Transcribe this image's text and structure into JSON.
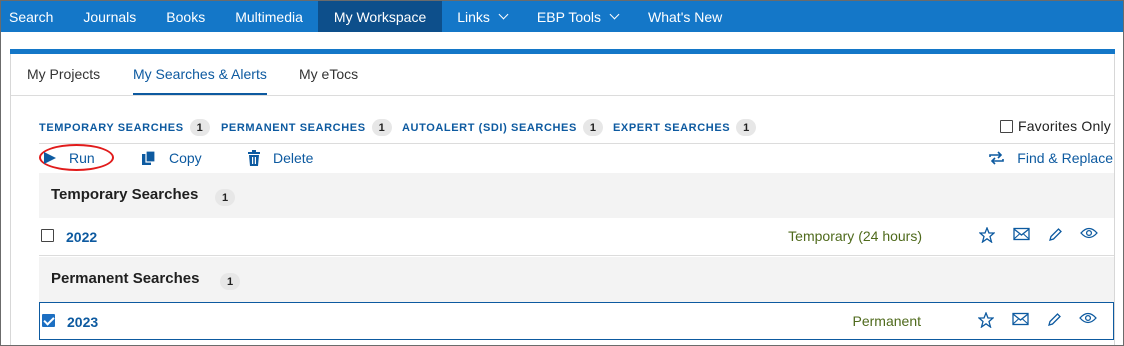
{
  "nav": {
    "items": [
      {
        "label": "Search"
      },
      {
        "label": "Journals"
      },
      {
        "label": "Books"
      },
      {
        "label": "Multimedia"
      },
      {
        "label": "My Workspace",
        "active": true
      },
      {
        "label": "Links",
        "dropdown": true
      },
      {
        "label": "EBP Tools",
        "dropdown": true
      },
      {
        "label": "What's New"
      }
    ]
  },
  "subtabs": [
    "My Projects",
    "My Searches & Alerts",
    "My eTocs"
  ],
  "filters": [
    {
      "label": "TEMPORARY SEARCHES",
      "count": "1"
    },
    {
      "label": "PERMANENT SEARCHES",
      "count": "1"
    },
    {
      "label": "AUTOALERT (SDI) SEARCHES",
      "count": "1"
    },
    {
      "label": "EXPERT SEARCHES",
      "count": "1"
    }
  ],
  "favorites_label": "Favorites Only",
  "actions": {
    "run": "Run",
    "copy": "Copy",
    "delete": "Delete",
    "find_replace": "Find & Replace"
  },
  "sections": [
    {
      "title": "Temporary Searches",
      "count": "1",
      "rows": [
        {
          "title": "2022",
          "status": "Temporary (24 hours)",
          "checked": false
        }
      ]
    },
    {
      "title": "Permanent Searches",
      "count": "1",
      "rows": [
        {
          "title": "2023",
          "status": "Permanent",
          "checked": true
        }
      ]
    }
  ],
  "colors": {
    "nav_bg": "#1477c8",
    "nav_active": "#0d4f8b",
    "link": "#0d5aa0",
    "status_green": "#4f6a1c",
    "highlight_circle": "#e11b1b"
  }
}
